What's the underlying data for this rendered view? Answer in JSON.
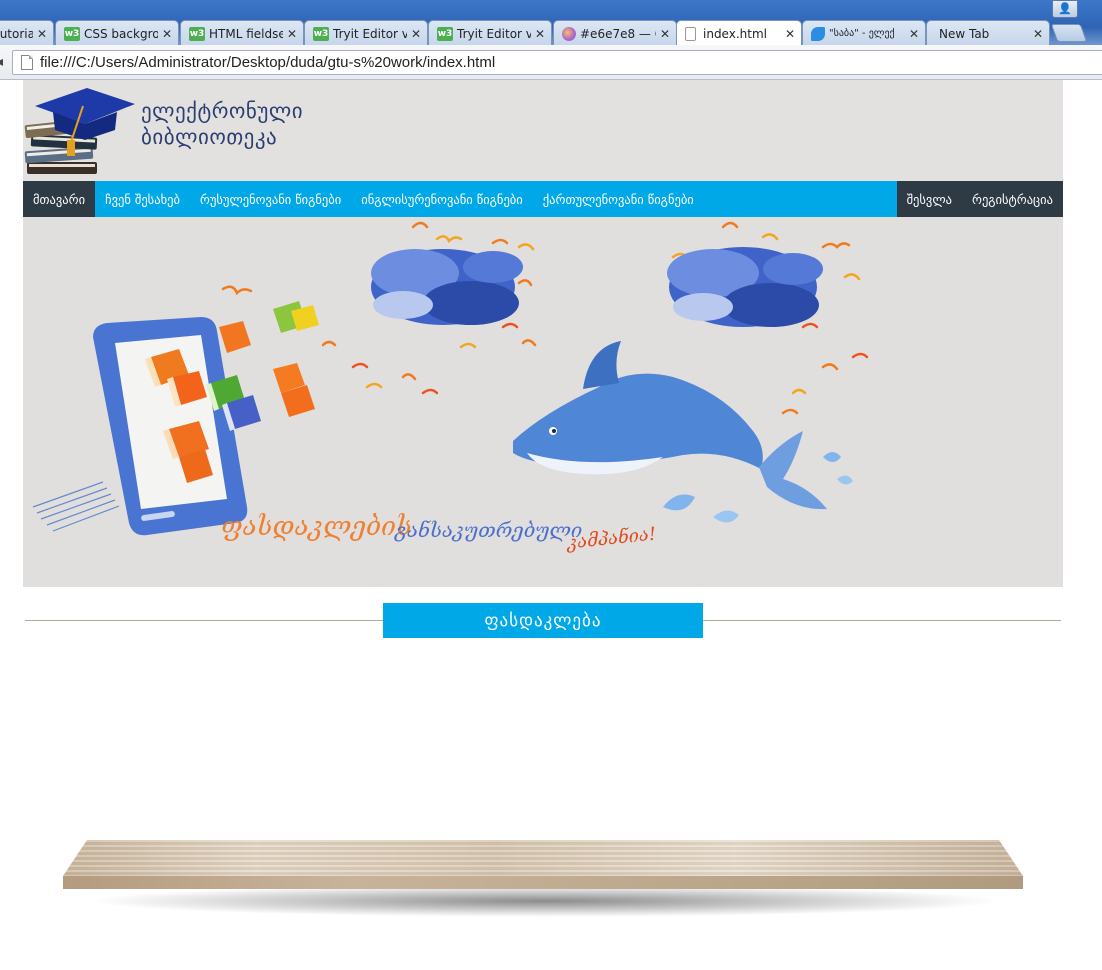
{
  "browser": {
    "tabs": [
      {
        "title": "tutorial",
        "icon": "none"
      },
      {
        "title": "CSS backgrou",
        "icon": "w3schools-icon"
      },
      {
        "title": "HTML fieldse",
        "icon": "w3schools-icon"
      },
      {
        "title": "Tryit Editor v",
        "icon": "w3schools-icon"
      },
      {
        "title": "Tryit Editor v",
        "icon": "w3schools-icon"
      },
      {
        "title": "#e6e7e8 — C",
        "icon": "palette-icon"
      },
      {
        "title": "index.html",
        "icon": "document-icon",
        "active": true
      },
      {
        "title": "\"საბა\" - ელექ",
        "icon": "bird-icon"
      },
      {
        "title": "New Tab",
        "icon": "none"
      }
    ],
    "close_glyph": "✕",
    "url": "file:///C:/Users/Administrator/Desktop/duda/gtu-s%20work/index.html"
  },
  "header": {
    "title_line1": "ელექტრონული",
    "title_line2": "ბიბლიოთეკა",
    "logo": "graduation-cap-books-logo"
  },
  "nav": {
    "left": [
      "მთავარი",
      "ჩვენ შესახებ",
      "რუსულენოვანი წიგნები",
      "ინგლისურენოვანი წიგნები",
      "ქართულენოვანი წიგნები"
    ],
    "right": [
      "შესვლა",
      "რეგისტრაცია"
    ],
    "active_index": 0
  },
  "hero": {
    "caption_word1": "ფასდაკლების",
    "caption_word2": "განსაკუთრებული",
    "caption_word3": "კამპანია!"
  },
  "section": {
    "title": "ფასდაკლება"
  },
  "colors": {
    "accent": "#00a8e8",
    "dark_nav": "#2e3a44",
    "header_bg": "#e2e1df",
    "title_text": "#2c3d70"
  }
}
